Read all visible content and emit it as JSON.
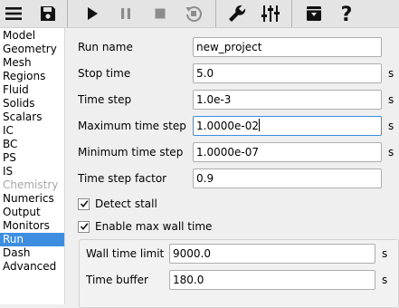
{
  "toolbar": {
    "buttons": [
      {
        "name": "menu",
        "icon": "hamburger-menu-icon",
        "enabled": true
      },
      {
        "name": "save",
        "icon": "save-icon",
        "enabled": true
      },
      {
        "name": "run",
        "icon": "play-icon",
        "enabled": true
      },
      {
        "name": "pause",
        "icon": "pause-icon",
        "enabled": false
      },
      {
        "name": "stop",
        "icon": "stop-icon",
        "enabled": false
      },
      {
        "name": "reset",
        "icon": "reset-icon",
        "enabled": false
      },
      {
        "name": "settings",
        "icon": "wrench-icon",
        "enabled": true
      },
      {
        "name": "parameters",
        "icon": "sliders-icon",
        "enabled": true
      },
      {
        "name": "export",
        "icon": "download-box-icon",
        "enabled": true
      },
      {
        "name": "help",
        "icon": "help-icon",
        "enabled": true
      }
    ]
  },
  "sidebar": {
    "items": [
      {
        "label": "Model",
        "state": "normal"
      },
      {
        "label": "Geometry",
        "state": "normal"
      },
      {
        "label": "Mesh",
        "state": "normal"
      },
      {
        "label": "Regions",
        "state": "normal"
      },
      {
        "label": "Fluid",
        "state": "normal"
      },
      {
        "label": "Solids",
        "state": "normal"
      },
      {
        "label": "Scalars",
        "state": "normal"
      },
      {
        "label": "IC",
        "state": "normal"
      },
      {
        "label": "BC",
        "state": "normal"
      },
      {
        "label": "PS",
        "state": "normal"
      },
      {
        "label": "IS",
        "state": "normal"
      },
      {
        "label": "Chemistry",
        "state": "disabled"
      },
      {
        "label": "Numerics",
        "state": "normal"
      },
      {
        "label": "Output",
        "state": "normal"
      },
      {
        "label": "Monitors",
        "state": "normal"
      },
      {
        "label": "Run",
        "state": "selected"
      },
      {
        "label": "Dash",
        "state": "normal"
      },
      {
        "label": "Advanced",
        "state": "normal"
      }
    ],
    "selected_color": "#3d8ee0"
  },
  "form": {
    "run_name": {
      "label": "Run name",
      "value": "new_project"
    },
    "stop_time": {
      "label": "Stop time",
      "value": "5.0",
      "unit": "s"
    },
    "time_step": {
      "label": "Time step",
      "value": "1.0e-3",
      "unit": "s"
    },
    "max_time_step": {
      "label": "Maximum time step",
      "value": "1.0000e-02",
      "unit": "s"
    },
    "min_time_step": {
      "label": "Minimum time step",
      "value": "1.0000e-07",
      "unit": "s"
    },
    "time_step_factor": {
      "label": "Time step factor",
      "value": "0.9"
    },
    "detect_stall": {
      "label": "Detect stall",
      "checked": true
    },
    "enable_max_wall_time": {
      "label": "Enable max wall time",
      "checked": true
    },
    "wall_time_limit": {
      "label": "Wall time limit",
      "value": "9000.0",
      "unit": "s"
    },
    "time_buffer": {
      "label": "Time buffer",
      "value": "180.0",
      "unit": "s"
    }
  }
}
